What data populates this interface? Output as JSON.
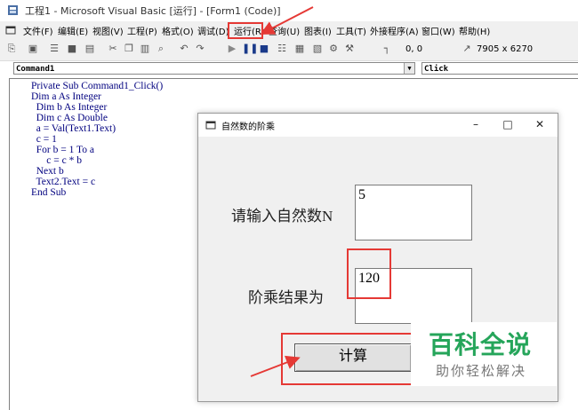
{
  "window": {
    "title": "工程1 - Microsoft Visual Basic [运行] - [Form1 (Code)]"
  },
  "menu": {
    "items": [
      "文件(F)",
      "编辑(E)",
      "视图(V)",
      "工程(P)",
      "格式(O)",
      "调试(D)",
      "运行(R)",
      "查询(U)",
      "图表(I)",
      "工具(T)",
      "外接程序(A)",
      "窗口(W)",
      "帮助(H)"
    ]
  },
  "toolbar": {
    "position": "0, 0",
    "size": "7905 x 6270"
  },
  "code_window": {
    "object_combo": "Command1",
    "proc_combo": "Click",
    "lines": [
      "Private Sub Command1_Click()",
      "Dim a As Integer",
      "  Dim b As Integer",
      "  Dim c As Double",
      "  a = Val(Text1.Text)",
      "  c = 1",
      "  For b = 1 To a",
      "      c = c * b",
      "  Next b",
      "  Text2.Text = c",
      "End Sub"
    ]
  },
  "dialog": {
    "title": "自然数的阶乘",
    "label1": "请输入自然数N",
    "label2": "阶乘结果为",
    "text1": "5",
    "text2": "120",
    "button": "计算"
  },
  "watermark": {
    "title": "百科全说",
    "subtitle": "助你轻松解决"
  },
  "colors": {
    "highlight": "#e53935",
    "code": "#00007f",
    "watermark": "#25a55a"
  }
}
